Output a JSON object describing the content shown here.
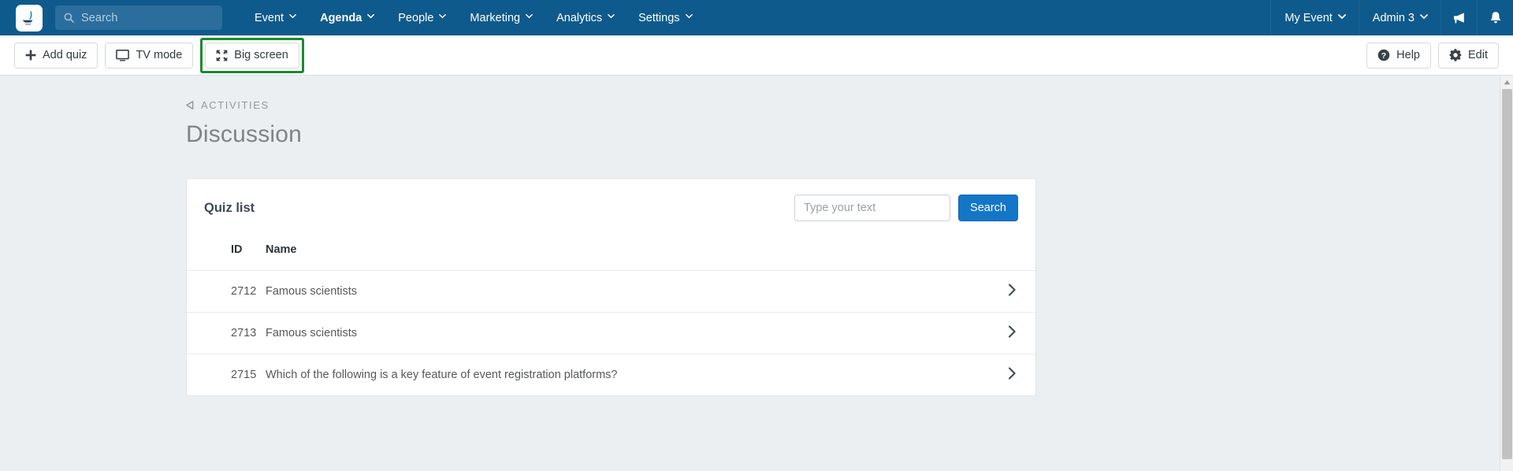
{
  "topnav": {
    "logo_name": "app-logo",
    "search": {
      "placeholder": "Search",
      "value": "",
      "icon": "search-icon"
    },
    "items": [
      {
        "label": "Event",
        "active": false
      },
      {
        "label": "Agenda",
        "active": true
      },
      {
        "label": "People",
        "active": false
      },
      {
        "label": "Marketing",
        "active": false
      },
      {
        "label": "Analytics",
        "active": false
      },
      {
        "label": "Settings",
        "active": false
      }
    ],
    "right": {
      "event_label": "My Event",
      "user_label": "Admin 3",
      "megaphone_icon": "megaphone-icon",
      "bell_icon": "bell-icon"
    },
    "bg_color": "#0f5a8c"
  },
  "toolbar": {
    "add_quiz_label": "Add quiz",
    "tv_mode_label": "TV mode",
    "big_screen_label": "Big screen",
    "help_label": "Help",
    "edit_label": "Edit",
    "highlight_color": "#1a8a2e",
    "big_screen_highlighted": true
  },
  "page": {
    "breadcrumb": "ACTIVITIES",
    "title": "Discussion"
  },
  "card": {
    "title": "Quiz list",
    "search": {
      "placeholder": "Type your text",
      "value": "",
      "button_label": "Search",
      "button_color": "#1476c6"
    },
    "columns": {
      "id": "ID",
      "name": "Name"
    },
    "rows": [
      {
        "id": "2712",
        "name": "Famous scientists"
      },
      {
        "id": "2713",
        "name": "Famous scientists"
      },
      {
        "id": "2715",
        "name": "Which of the following is a key feature of event registration platforms?"
      }
    ]
  },
  "scrollbar": {
    "up_arrow_icon": "scroll-up-arrow-icon"
  }
}
